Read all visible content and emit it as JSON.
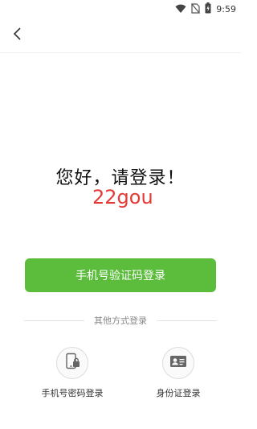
{
  "status_bar": {
    "time": "9:59"
  },
  "greeting": "您好，请登录！",
  "brand": "22gou",
  "colors": {
    "accent": "#5bbd3b",
    "brand": "#e53935"
  },
  "primary_button": {
    "label": "手机号验证码登录"
  },
  "divider": {
    "text": "其他方式登录"
  },
  "alt_options": [
    {
      "label": "手机号密码登录",
      "icon": "phone-lock-icon"
    },
    {
      "label": "身份证登录",
      "icon": "id-card-icon"
    }
  ]
}
